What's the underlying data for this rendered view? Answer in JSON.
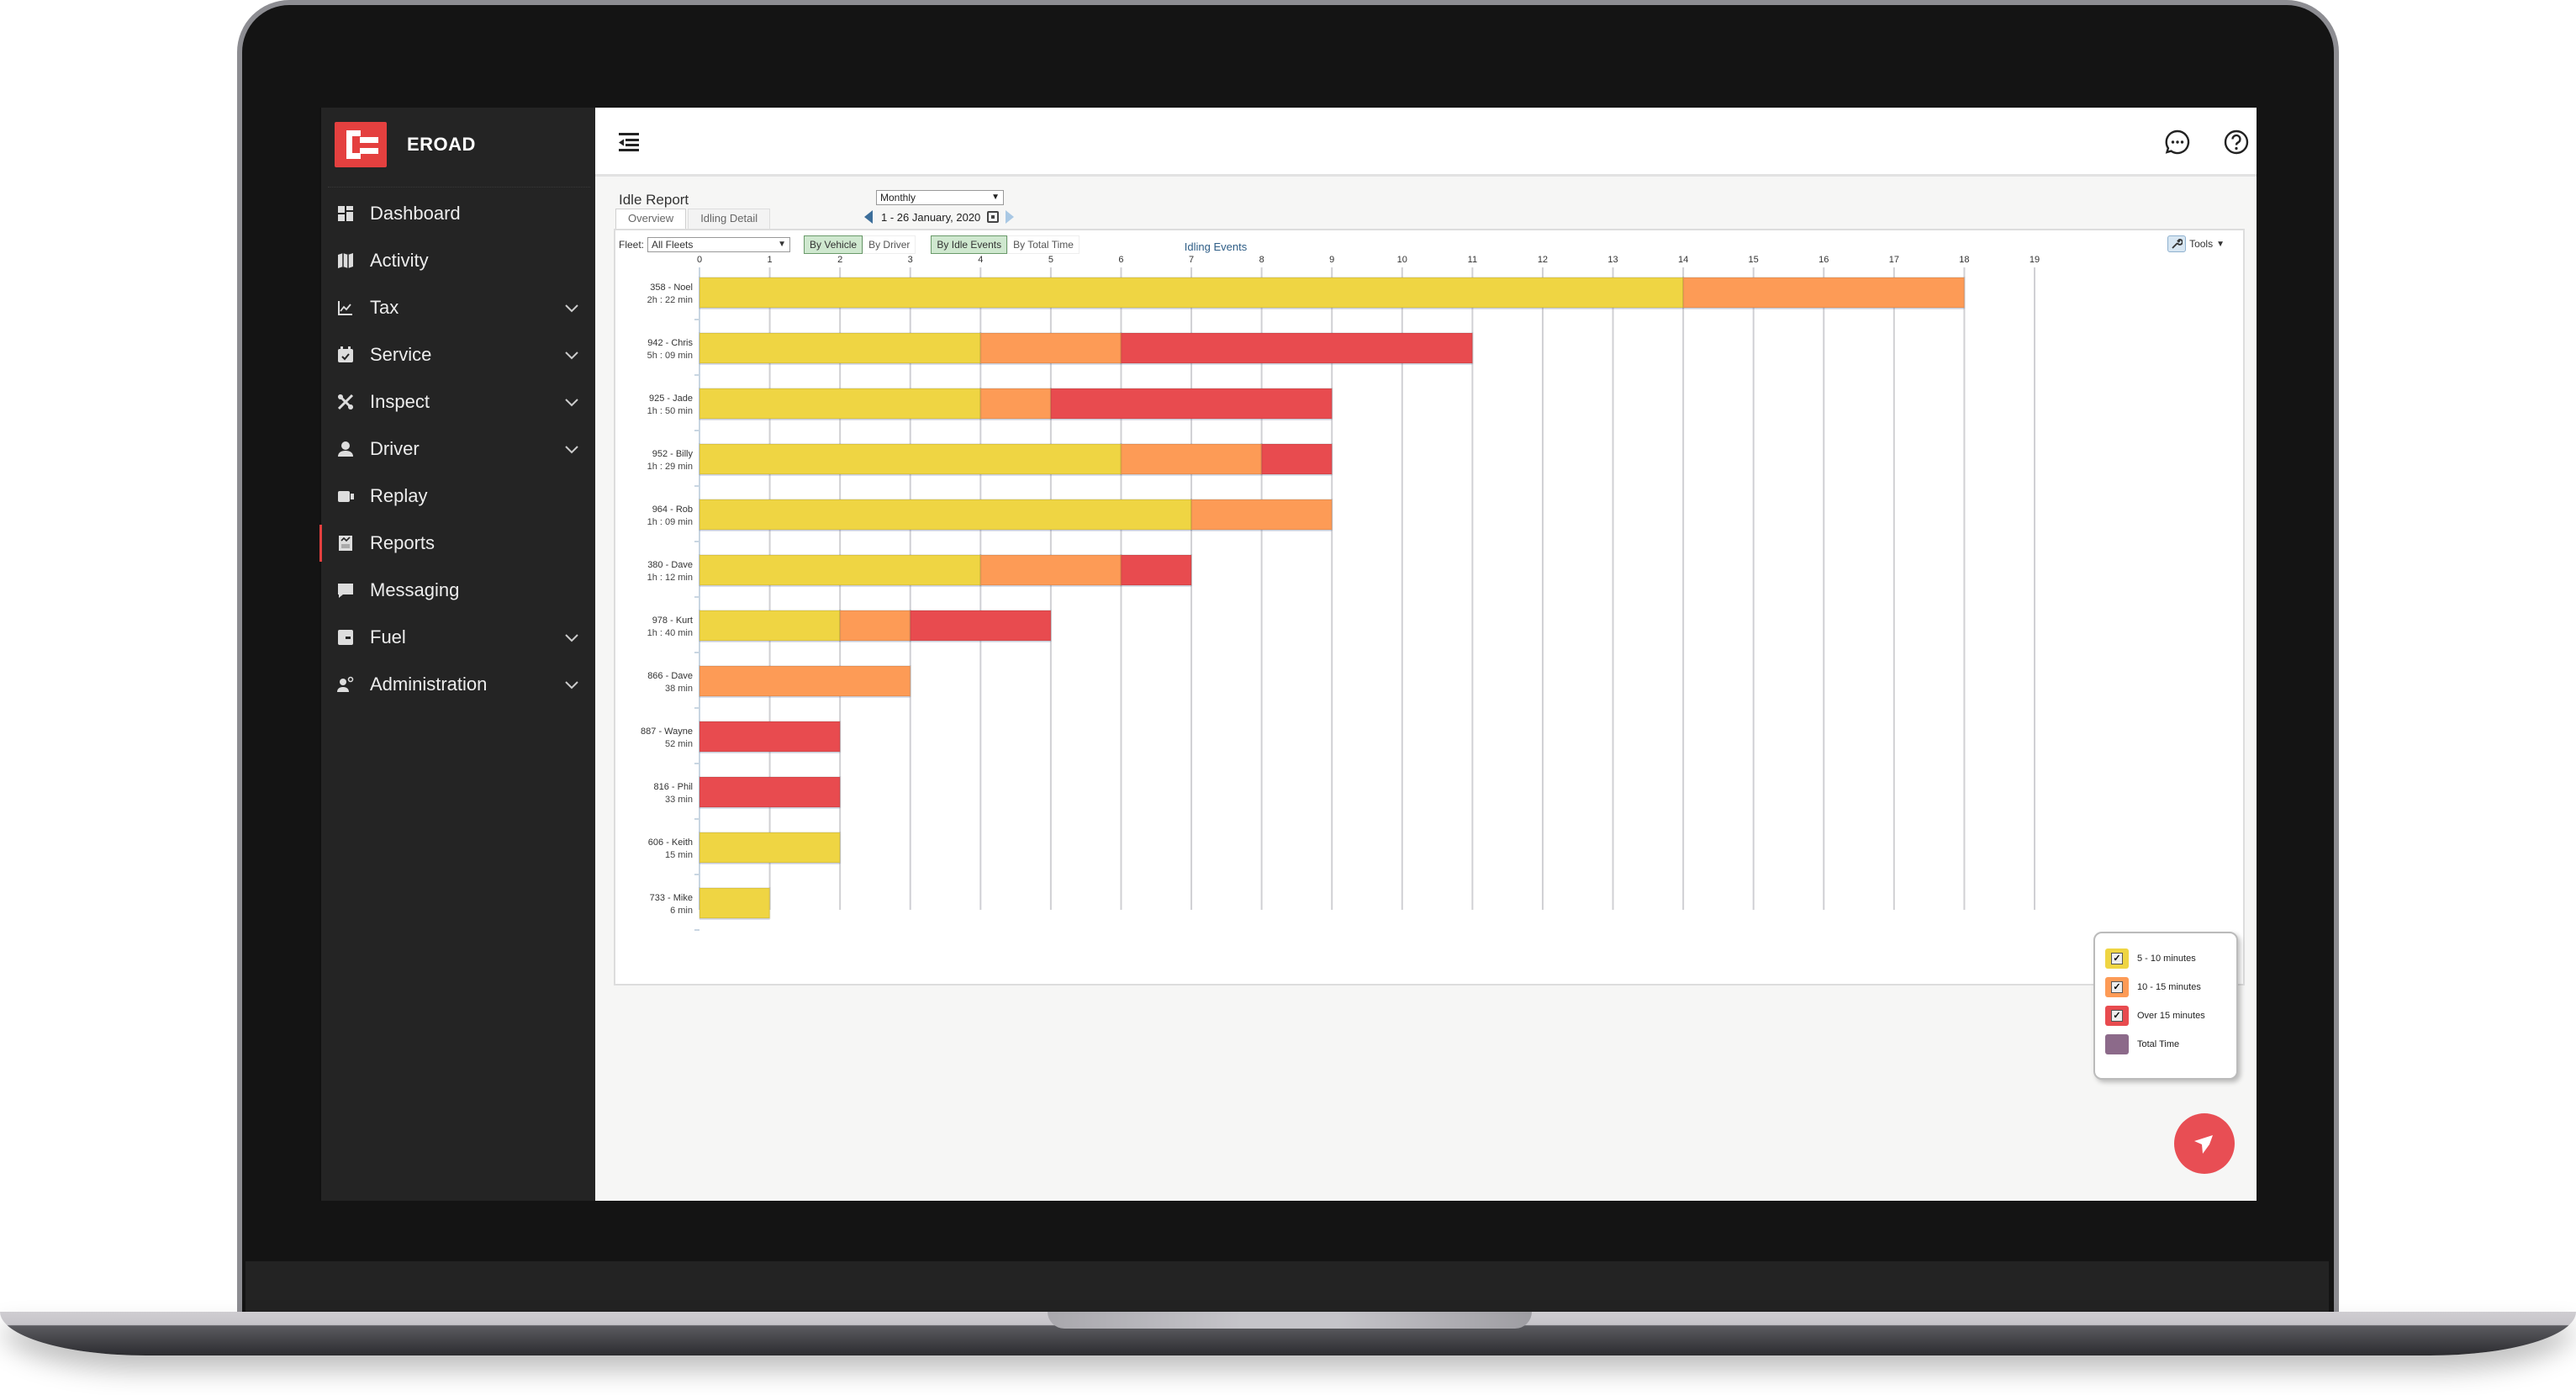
{
  "brand": {
    "name": "EROAD",
    "accent": "#e4403f"
  },
  "sidebar": {
    "items": [
      {
        "label": "Dashboard",
        "icon": "dashboard-icon",
        "expandable": false,
        "active": false
      },
      {
        "label": "Activity",
        "icon": "map-icon",
        "expandable": false,
        "active": false
      },
      {
        "label": "Tax",
        "icon": "line-chart-icon",
        "expandable": true,
        "active": false
      },
      {
        "label": "Service",
        "icon": "calendar-check-icon",
        "expandable": true,
        "active": false
      },
      {
        "label": "Inspect",
        "icon": "tools-icon",
        "expandable": true,
        "active": false
      },
      {
        "label": "Driver",
        "icon": "person-icon",
        "expandable": true,
        "active": false
      },
      {
        "label": "Replay",
        "icon": "video-icon",
        "expandable": false,
        "active": false
      },
      {
        "label": "Reports",
        "icon": "report-icon",
        "expandable": false,
        "active": true
      },
      {
        "label": "Messaging",
        "icon": "message-icon",
        "expandable": false,
        "active": false
      },
      {
        "label": "Fuel",
        "icon": "fuel-icon",
        "expandable": true,
        "active": false
      },
      {
        "label": "Administration",
        "icon": "admin-icon",
        "expandable": true,
        "active": false
      }
    ]
  },
  "topbar": {
    "icons": [
      "chat-icon",
      "help-icon",
      "settings-icon"
    ]
  },
  "report": {
    "title": "Idle Report",
    "tabs": [
      {
        "label": "Overview",
        "active": true
      },
      {
        "label": "Idling Detail",
        "active": false
      }
    ],
    "period_select": "Monthly",
    "date_range": "1 - 26 January, 2020",
    "fleet_label": "Fleet:",
    "fleet_value": "All Fleets",
    "group_toggle": [
      {
        "label": "By Vehicle",
        "active": true
      },
      {
        "label": "By Driver",
        "active": false
      }
    ],
    "measure_toggle": [
      {
        "label": "By Idle Events",
        "active": true
      },
      {
        "label": "By Total Time",
        "active": false
      }
    ],
    "tools_label": "Tools"
  },
  "chart_data": {
    "type": "bar",
    "orientation": "horizontal",
    "stacked": true,
    "title": "Idling Events",
    "xlabel": "",
    "ylabel": "",
    "xlim": [
      0,
      19
    ],
    "x_ticks": [
      0,
      1,
      2,
      3,
      4,
      5,
      6,
      7,
      8,
      9,
      10,
      11,
      12,
      13,
      14,
      15,
      16,
      17,
      18,
      19
    ],
    "grid": true,
    "legend_position": "bottom-right",
    "categories": [
      {
        "label": "358 - Noel",
        "sub": "2h : 22 min"
      },
      {
        "label": "942 - Chris",
        "sub": "5h : 09 min"
      },
      {
        "label": "925 - Jade",
        "sub": "1h : 50 min"
      },
      {
        "label": "952 - Billy",
        "sub": "1h : 29 min"
      },
      {
        "label": "964 - Rob",
        "sub": "1h : 09 min"
      },
      {
        "label": "380 - Dave",
        "sub": "1h : 12 min"
      },
      {
        "label": "978 - Kurt",
        "sub": "1h : 40 min"
      },
      {
        "label": "866 - Dave",
        "sub": "38 min"
      },
      {
        "label": "887 - Wayne",
        "sub": "52 min"
      },
      {
        "label": "816 - Phil",
        "sub": "33 min"
      },
      {
        "label": "606 - Keith",
        "sub": "15 min"
      },
      {
        "label": "733 - Mike",
        "sub": "6 min"
      }
    ],
    "series": [
      {
        "name": "5 - 10 minutes",
        "color": "#efd543",
        "values": [
          14,
          4,
          4,
          6,
          7,
          4,
          2,
          0,
          0,
          0,
          2,
          1
        ]
      },
      {
        "name": "10 - 15 minutes",
        "color": "#fd9b56",
        "values": [
          4,
          2,
          1,
          2,
          2,
          2,
          1,
          3,
          0,
          0,
          0,
          0
        ]
      },
      {
        "name": "Over 15 minutes",
        "color": "#e84b4f",
        "values": [
          0,
          5,
          4,
          1,
          0,
          1,
          2,
          0,
          2,
          2,
          0,
          0
        ]
      }
    ],
    "legend": [
      {
        "name": "5 - 10 minutes",
        "color": "#efd543",
        "checked": true
      },
      {
        "name": "10 - 15 minutes",
        "color": "#fd9b56",
        "checked": true
      },
      {
        "name": "Over 15 minutes",
        "color": "#e84b4f",
        "checked": true
      },
      {
        "name": "Total Time",
        "color": "#8c6a8a",
        "checked": false
      }
    ]
  }
}
